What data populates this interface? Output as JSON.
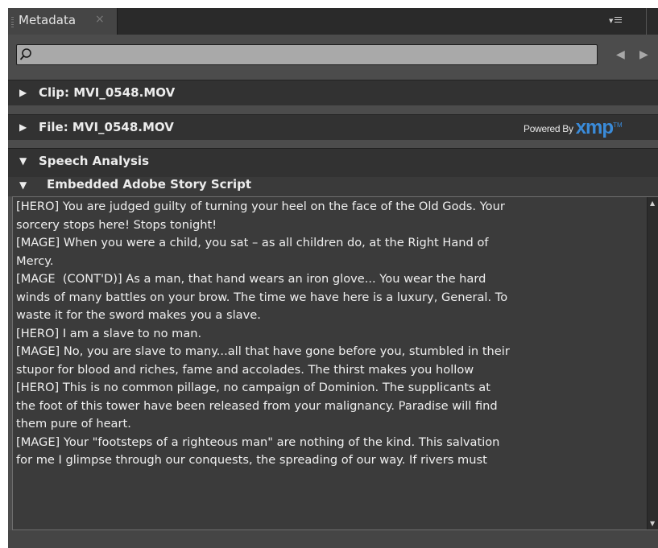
{
  "panel": {
    "tab_title": "Metadata",
    "close_glyph": "×",
    "menu_icon": "panel-menu-icon"
  },
  "search": {
    "value": "",
    "placeholder": "",
    "icon": "search-icon",
    "prev_glyph": "◀",
    "next_glyph": "▶"
  },
  "sections": [
    {
      "label": "Clip: MVI_0548.MOV",
      "arrow": "▶",
      "expanded": false
    },
    {
      "label": "File: MVI_0548.MOV",
      "arrow": "▶",
      "expanded": false,
      "badge": {
        "powered_by": "Powered By",
        "brand": "xmp",
        "tm": "TM"
      }
    },
    {
      "label": "Speech Analysis",
      "arrow": "▼",
      "expanded": true
    },
    {
      "label": "Embedded Adobe Story Script",
      "arrow": "▼",
      "expanded": true
    }
  ],
  "script_lines": [
    "[HERO] You are judged guilty of turning your heel on the face of the Old Gods. Your",
    "sorcery stops here! Stops tonight!",
    "[MAGE] When you were a child, you sat – as all children do, at the Right Hand of",
    "Mercy.",
    "[MAGE  (CONT'D)] As a man, that hand wears an iron glove... You wear the hard",
    "winds of many battles on your brow. The time we have here is a luxury, General. To",
    "waste it for the sword makes you a slave.",
    "[HERO] I am a slave to no man.",
    "[MAGE] No, you are slave to many...all that have gone before you, stumbled in their",
    "stupor for blood and riches, fame and accolades. The thirst makes you hollow",
    "[HERO] This is no common pillage, no campaign of Dominion. The supplicants at",
    "the foot of this tower have been released from your malignancy. Paradise will find",
    "them pure of heart.",
    "[MAGE] Your \"footsteps of a righteous man\" are nothing of the kind. This salvation",
    "for me I glimpse through our conquests, the spreading of our way. If rivers must"
  ],
  "colors": {
    "panel_bg": "#4c4c4c",
    "header_bg": "#323232",
    "text": "#efefef",
    "xmp_blue": "#3a8bd9"
  }
}
